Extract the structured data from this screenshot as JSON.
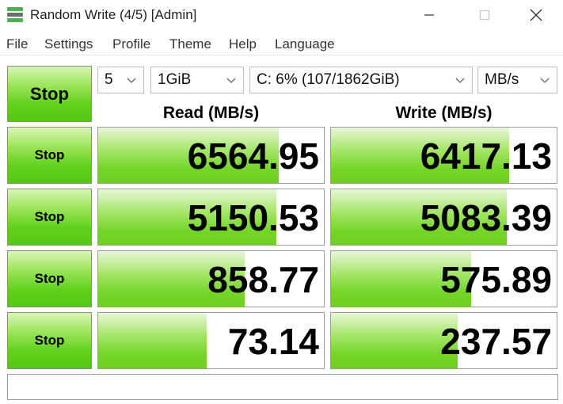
{
  "window": {
    "title": "Random Write (4/5) [Admin]",
    "icon": "crystaldiskmark-icon",
    "icon_colors": [
      "#4caf50",
      "#6e6e6e",
      "#4caf50"
    ]
  },
  "menu": [
    "File",
    "Settings",
    "Profile",
    "Theme",
    "Help",
    "Language"
  ],
  "controls": {
    "main_button_label": "Stop",
    "count": "5",
    "size": "1GiB",
    "drive": "C: 6% (107/1862GiB)",
    "unit": "MB/s"
  },
  "headers": {
    "read": "Read (MB/s)",
    "write": "Write (MB/s)"
  },
  "rows": [
    {
      "button": "Stop",
      "read": "6564.95",
      "write": "6417.13",
      "read_fill": 0.8,
      "write_fill": 0.79
    },
    {
      "button": "Stop",
      "read": "5150.53",
      "write": "5083.39",
      "read_fill": 0.79,
      "write_fill": 0.78
    },
    {
      "button": "Stop",
      "read": "858.77",
      "write": "575.89",
      "read_fill": 0.65,
      "write_fill": 0.62
    },
    {
      "button": "Stop",
      "read": "73.14",
      "write": "237.57",
      "read_fill": 0.48,
      "write_fill": 0.56
    }
  ],
  "status": "",
  "colors": {
    "accent_green": "#5fd11a",
    "bar_green": "#74d528"
  }
}
